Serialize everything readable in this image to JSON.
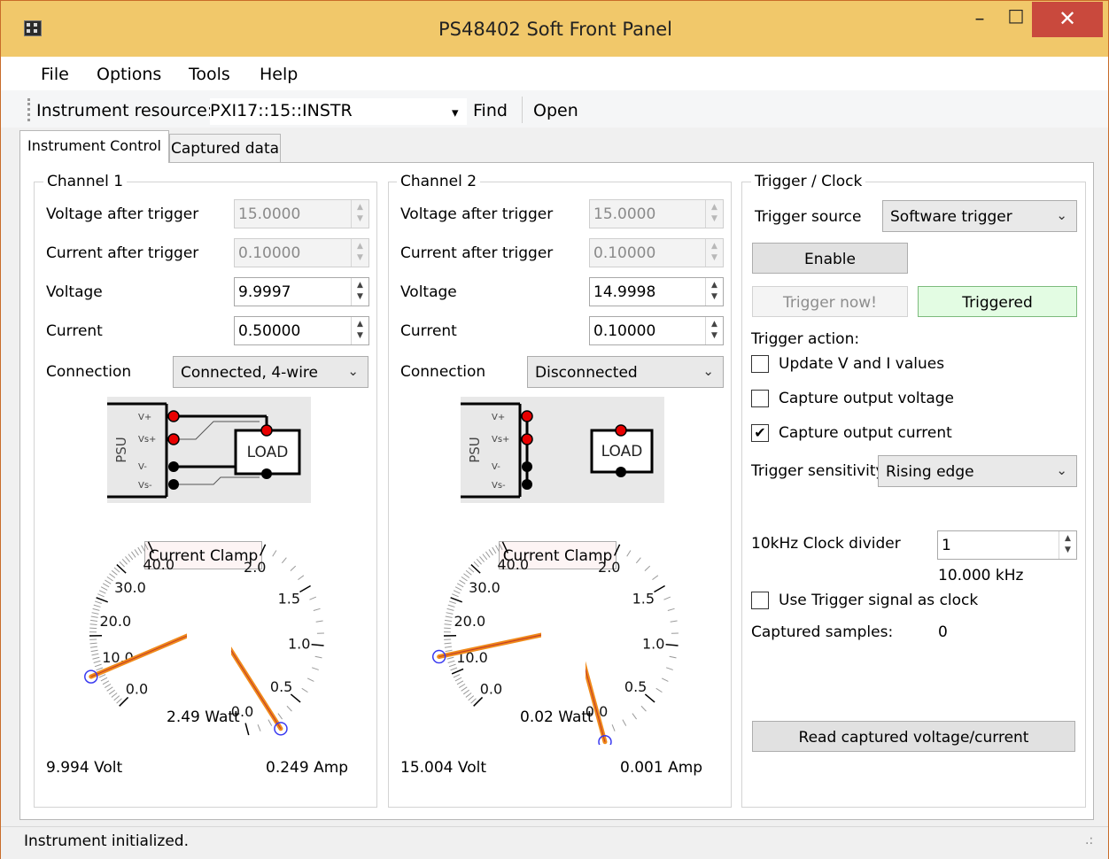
{
  "window": {
    "title": "PS48402 Soft Front Panel",
    "minimize_glyph": "–",
    "maximize_glyph": "□",
    "close_glyph": "✕",
    "close_color": "#c9493d",
    "title_bar_color": "#f1c86a"
  },
  "menu": [
    "File",
    "Options",
    "Tools",
    "Help"
  ],
  "toolbar": {
    "resource_label": "Instrument resource:",
    "resource_value": "PXI17::15::INSTR",
    "dropdown_glyph": "▾",
    "find_label": "Find",
    "open_label": "Open"
  },
  "tabs": [
    {
      "label": "Instrument Control",
      "active": true
    },
    {
      "label": "Captured data",
      "active": false
    }
  ],
  "channels": [
    {
      "title": "Channel 1",
      "voltage_after_trigger_label": "Voltage after trigger",
      "voltage_after_trigger": "15.0000",
      "current_after_trigger_label": "Current after trigger",
      "current_after_trigger": "0.10000",
      "voltage_label": "Voltage",
      "voltage": "9.9997",
      "current_label": "Current",
      "current": "0.50000",
      "connection_label": "Connection",
      "connection": "Connected, 4-wire",
      "diagram": {
        "psu_label": "PSU",
        "pins": [
          "V+",
          "Vs+",
          "V-",
          "Vs-"
        ],
        "load_label": "LOAD",
        "connected": true
      },
      "current_clamp_label": "Current Clamp",
      "voltage_gauge": {
        "ticks": [
          "0.0",
          "10.0",
          "20.0",
          "30.0",
          "40.0"
        ],
        "value": 9.994,
        "max": 50
      },
      "current_gauge": {
        "ticks": [
          "0.0",
          "0.5",
          "1.0",
          "1.5",
          "2.0"
        ],
        "value": 0.249,
        "max": 2.0
      },
      "watt_readout": "2.49 Watt",
      "volt_readout": "9.994 Volt",
      "amp_readout": "0.249 Amp"
    },
    {
      "title": "Channel 2",
      "voltage_after_trigger_label": "Voltage after trigger",
      "voltage_after_trigger": "15.0000",
      "current_after_trigger_label": "Current after trigger",
      "current_after_trigger": "0.10000",
      "voltage_label": "Voltage",
      "voltage": "14.9998",
      "current_label": "Current",
      "current": "0.10000",
      "connection_label": "Connection",
      "connection": "Disconnected",
      "diagram": {
        "psu_label": "PSU",
        "pins": [
          "V+",
          "Vs+",
          "V-",
          "Vs-"
        ],
        "load_label": "LOAD",
        "connected": false
      },
      "current_clamp_label": "Current Clamp",
      "voltage_gauge": {
        "ticks": [
          "0.0",
          "10.0",
          "20.0",
          "30.0",
          "40.0"
        ],
        "value": 15.004,
        "max": 50
      },
      "current_gauge": {
        "ticks": [
          "0.0",
          "0.5",
          "1.0",
          "1.5",
          "2.0"
        ],
        "value": 0.001,
        "max": 2.0
      },
      "watt_readout": "0.02 Watt",
      "volt_readout": "15.004 Volt",
      "amp_readout": "0.001 Amp"
    }
  ],
  "trigger": {
    "title": "Trigger / Clock",
    "source_label": "Trigger source",
    "source_value": "Software trigger",
    "enable_label": "Enable",
    "trigger_now_label": "Trigger now!",
    "triggered_label": "Triggered",
    "triggered_color": "#e3fce3",
    "action_label": "Trigger action:",
    "actions": [
      {
        "label": "Update V and I values",
        "checked": false
      },
      {
        "label": "Capture output voltage",
        "checked": false
      },
      {
        "label": "Capture output current",
        "checked": true
      }
    ],
    "sensitivity_label": "Trigger sensitivity",
    "sensitivity_value": "Rising edge",
    "clock_divider_label": "10kHz Clock divider",
    "clock_divider_value": "1",
    "clock_freq": "10.000 kHz",
    "use_trigger_clock_label": "Use Trigger signal as clock",
    "use_trigger_clock_checked": false,
    "captured_samples_label": "Captured samples:",
    "captured_samples_value": "0",
    "read_button_label": "Read captured voltage/current"
  },
  "check_glyph": "✔",
  "spin_up_glyph": "▲",
  "spin_down_glyph": "▼",
  "combo_chevron_glyph": "⌄",
  "status_text": "Instrument initialized.",
  "size_grip_glyph": ".:"
}
